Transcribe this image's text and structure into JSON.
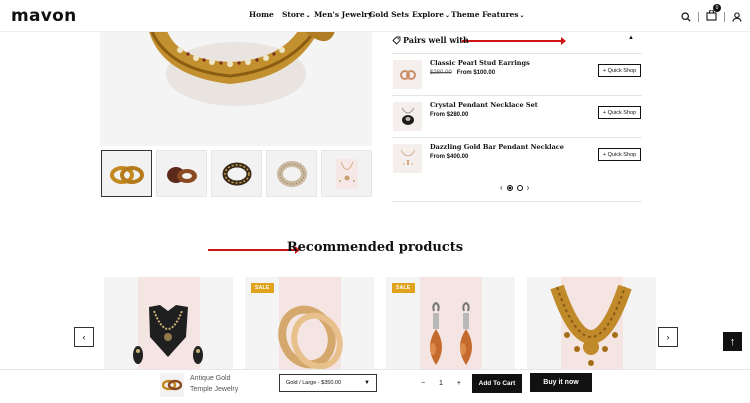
{
  "header": {
    "logo": "mavon",
    "nav": [
      {
        "label": "Home"
      },
      {
        "label": "Store"
      },
      {
        "label": "Men's Jewelry"
      },
      {
        "label": "Gold Sets"
      },
      {
        "label": "Explore"
      },
      {
        "label": "Theme Features"
      }
    ],
    "cart_count": "0",
    "icons": [
      "search-icon",
      "cart-icon",
      "user-icon"
    ]
  },
  "pairs": {
    "title": "Pairs well with",
    "items": [
      {
        "name": "Classic Pearl Stud Earrings",
        "old_price": "$280.00",
        "price": "From $100.00",
        "button": "+ Quick Shop"
      },
      {
        "name": "Crystal Pendant Necklace Set",
        "old_price": "",
        "price": "From $280.00",
        "button": "+ Quick Shop"
      },
      {
        "name": "Dazzling Gold Bar Pendant Necklace",
        "old_price": "",
        "price": "From $400.00",
        "button": "+ Quick Shop"
      }
    ]
  },
  "recommended": {
    "title": "Recommended products",
    "cards": [
      {
        "badge": ""
      },
      {
        "badge": "SALE"
      },
      {
        "badge": "SALE"
      },
      {
        "badge": ""
      }
    ]
  },
  "sticky": {
    "product_name": "Antique Gold Temple Jewelry",
    "variant": "Gold / Large - $350.00",
    "quantity": "1",
    "minus": "−",
    "plus": "+",
    "add_to_cart": "Add To Cart",
    "buy_now": "Buy it now"
  },
  "colors": {
    "accent_arrow": "#d01414",
    "sale_badge": "#e0a31b",
    "dark": "#111111"
  }
}
